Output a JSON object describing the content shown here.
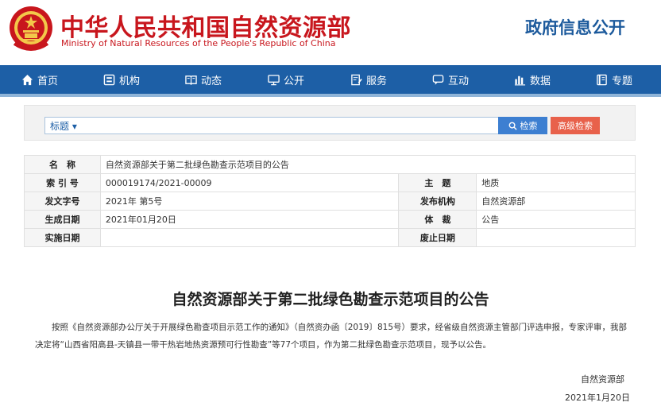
{
  "header": {
    "title_zh": "中华人民共和国自然资源部",
    "title_en": "Ministry of Natural Resources of the People's Republic of China",
    "gov_info": "政府信息公开"
  },
  "nav": [
    {
      "label": "首页",
      "icon": "home-icon"
    },
    {
      "label": "机构",
      "icon": "building-icon"
    },
    {
      "label": "动态",
      "icon": "book-icon"
    },
    {
      "label": "公开",
      "icon": "monitor-icon"
    },
    {
      "label": "服务",
      "icon": "document-edit-icon"
    },
    {
      "label": "互动",
      "icon": "chat-icon"
    },
    {
      "label": "数据",
      "icon": "bar-chart-icon"
    },
    {
      "label": "专题",
      "icon": "notebook-icon"
    }
  ],
  "search": {
    "type_label": "标题 ▾",
    "value": "",
    "search_button": "检索",
    "advanced_button": "高级检索"
  },
  "meta": {
    "name_label": "名　称",
    "name_value": "自然资源部关于第二批绿色勘查示范项目的公告",
    "index_label": "索 引 号",
    "index_value": "000019174/2021-00009",
    "subject_label": "主　题",
    "subject_value": "地质",
    "doc_no_label": "发文字号",
    "doc_no_value": "2021年 第5号",
    "issuer_label": "发布机构",
    "issuer_value": "自然资源部",
    "created_label": "生成日期",
    "created_value": "2021年01月20日",
    "genre_label": "体　裁",
    "genre_value": "公告",
    "effective_label": "实施日期",
    "effective_value": "",
    "expiry_label": "废止日期",
    "expiry_value": ""
  },
  "article": {
    "title": "自然资源部关于第二批绿色勘查示范项目的公告",
    "body": "按照《自然资源部办公厅关于开展绿色勘查项目示范工作的通知》（自然资办函〔2019〕815号）要求，经省级自然资源主管部门评选申报，专家评审，我部决定将“山西省阳高县-天镇县一带干热岩地热资源预可行性勘查”等77个项目，作为第二批绿色勘查示范项目，现予以公告。",
    "signature": "自然资源部",
    "date": "2021年1月20日"
  },
  "colors": {
    "brand_red": "#c8161d",
    "nav_blue": "#1d5fa6",
    "search_blue": "#3d7fd1",
    "advanced_red": "#e8614b"
  }
}
